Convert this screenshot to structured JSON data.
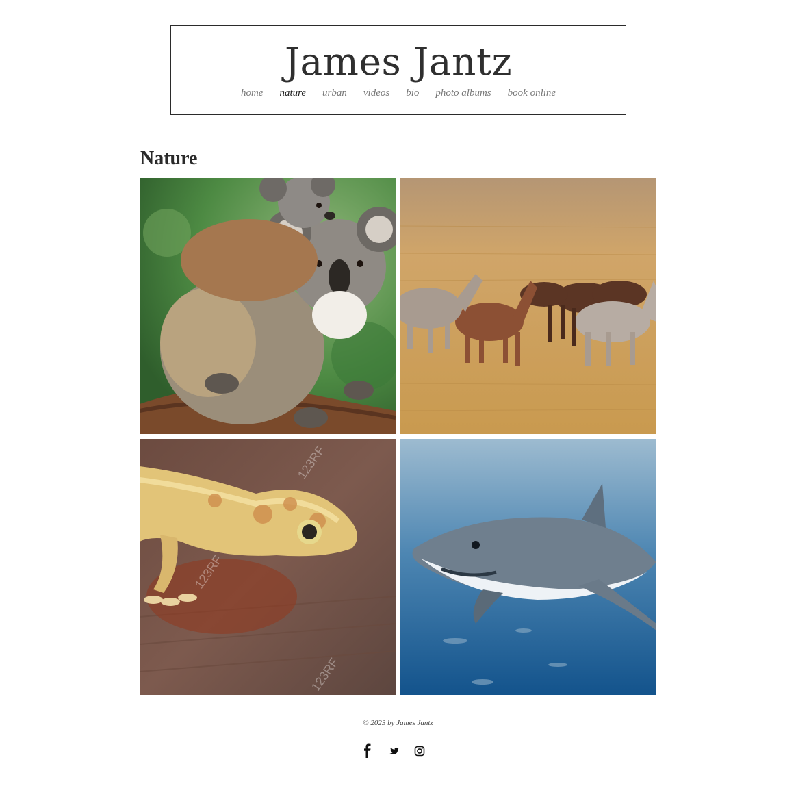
{
  "site": {
    "title": "James Jantz"
  },
  "nav": {
    "items": [
      {
        "label": "home",
        "active": false
      },
      {
        "label": "nature",
        "active": true
      },
      {
        "label": "urban",
        "active": false
      },
      {
        "label": "videos",
        "active": false
      },
      {
        "label": "bio",
        "active": false
      },
      {
        "label": "photo albums",
        "active": false
      },
      {
        "label": "book online",
        "active": false
      }
    ]
  },
  "page": {
    "title": "Nature"
  },
  "gallery": {
    "photos": [
      {
        "subject": "koala-photo",
        "watermark": ""
      },
      {
        "subject": "horses-photo",
        "watermark": ""
      },
      {
        "subject": "gecko-photo",
        "watermark": "123RF"
      },
      {
        "subject": "shark-photo",
        "watermark": ""
      }
    ]
  },
  "footer": {
    "copyright": "© 2023 by James Jantz",
    "social": [
      "facebook-icon",
      "twitter-icon",
      "instagram-icon"
    ]
  }
}
